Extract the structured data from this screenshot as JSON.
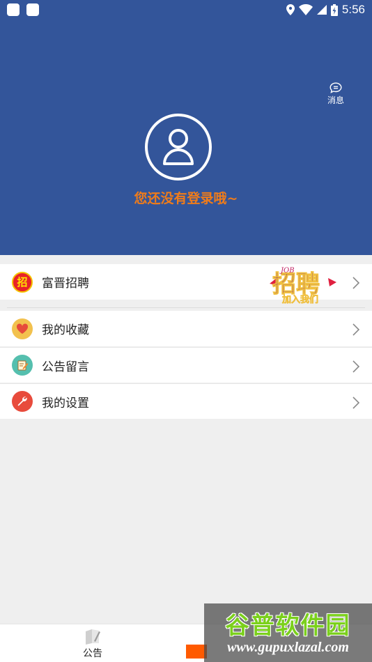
{
  "status_bar": {
    "time": "5:56"
  },
  "header": {
    "message_label": "消息",
    "login_prompt": "您还没有登录哦~"
  },
  "menu": {
    "recruit": {
      "label": "富晋招聘",
      "banner_text": "招聘",
      "banner_sub": "加入我们",
      "banner_top": "JOB"
    },
    "favorites": {
      "label": "我的收藏"
    },
    "notice_comments": {
      "label": "公告留言"
    },
    "settings": {
      "label": "我的设置"
    }
  },
  "tabbar": {
    "announcements_label": "公告"
  },
  "watermark": {
    "title": "谷普软件园",
    "url": "www.gupuxlazal.com"
  },
  "colors": {
    "header_bg": "#33559a",
    "login_text": "#f07c1a",
    "tab_accent": "#ff5a00"
  }
}
